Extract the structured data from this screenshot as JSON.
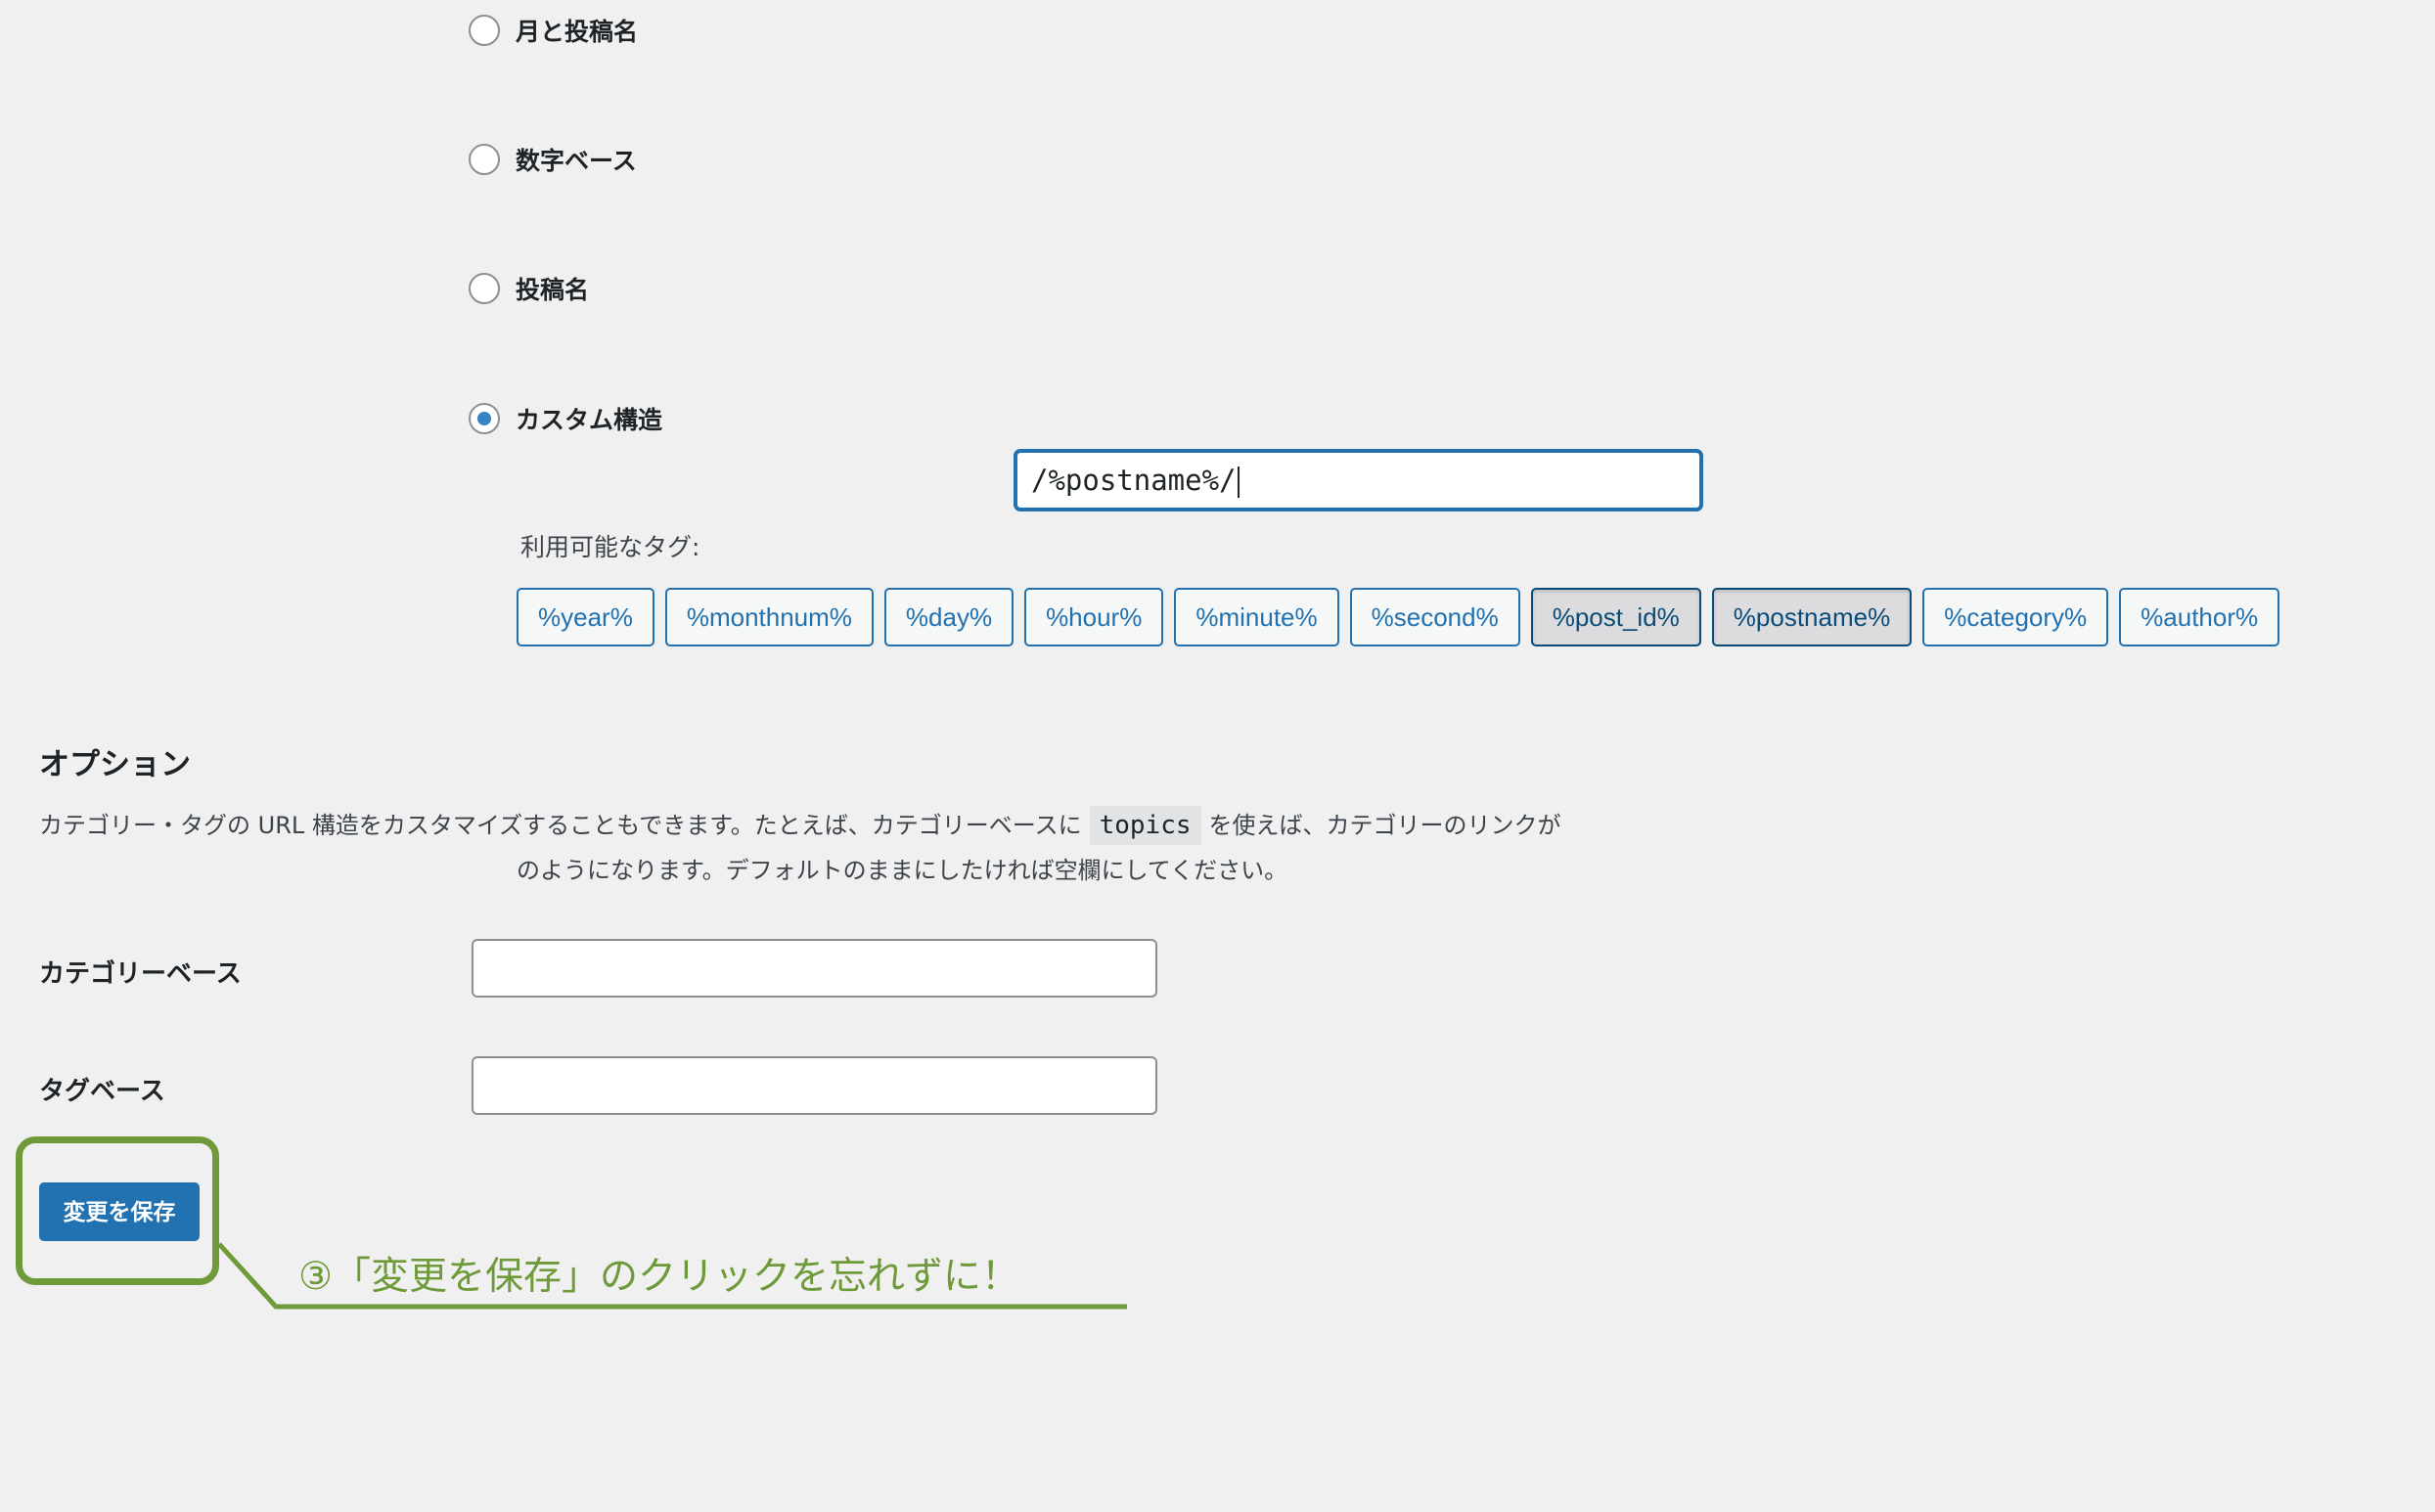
{
  "permalink_options": [
    {
      "label": "月と投稿名",
      "checked": false
    },
    {
      "label": "数字ベース",
      "checked": false
    },
    {
      "label": "投稿名",
      "checked": false
    },
    {
      "label": "カスタム構造",
      "checked": true
    }
  ],
  "custom_structure": {
    "value": "/%postname%/"
  },
  "available_tags": {
    "label": "利用可能なタグ:",
    "tags": [
      {
        "label": "%year%",
        "active": false
      },
      {
        "label": "%monthnum%",
        "active": false
      },
      {
        "label": "%day%",
        "active": false
      },
      {
        "label": "%hour%",
        "active": false
      },
      {
        "label": "%minute%",
        "active": false
      },
      {
        "label": "%second%",
        "active": false
      },
      {
        "label": "%post_id%",
        "active": true
      },
      {
        "label": "%postname%",
        "active": true
      },
      {
        "label": "%category%",
        "active": false
      },
      {
        "label": "%author%",
        "active": false
      }
    ]
  },
  "options": {
    "heading": "オプション",
    "description_part1": "カテゴリー・タグの URL 構造をカスタマイズすることもできます。たとえば、カテゴリーベースに",
    "description_code": "topics",
    "description_part2": "を使えば、カテゴリーのリンクが",
    "description_line2": "のようになります。デフォルトのままにしたければ空欄にしてください。"
  },
  "fields": {
    "category_base_label": "カテゴリーベース",
    "category_base_value": "",
    "tag_base_label": "タグベース",
    "tag_base_value": ""
  },
  "save_button": {
    "label": "変更を保存"
  },
  "annotation": {
    "text": "③「変更を保存」のクリックを忘れずに！",
    "color": "#6f9a3a"
  },
  "colors": {
    "background": "#f0f0f1",
    "accent": "#2271b1"
  }
}
